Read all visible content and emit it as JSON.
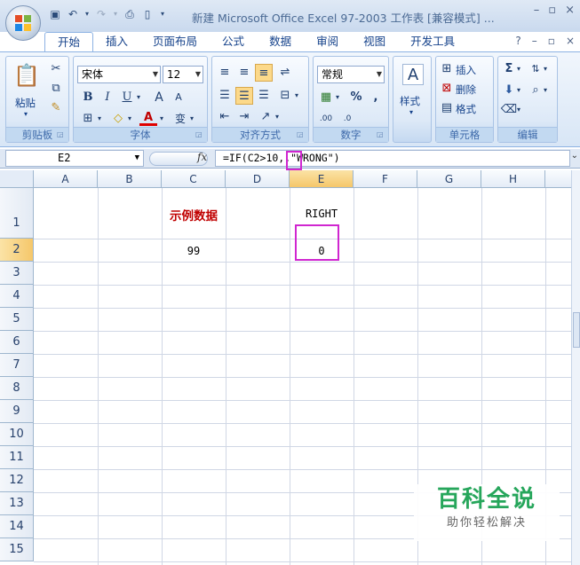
{
  "window": {
    "title": "新建 Microsoft Office Excel 97-2003 工作表  [兼容模式] ...",
    "controls": [
      "–",
      "▫",
      "×"
    ]
  },
  "tabs": [
    "开始",
    "插入",
    "页面布局",
    "公式",
    "数据",
    "审阅",
    "视图",
    "开发工具"
  ],
  "tabs_right": [
    "?",
    "–",
    "▫",
    "×"
  ],
  "ribbon": {
    "clipboard": {
      "label": "剪贴板",
      "paste": "粘贴"
    },
    "font": {
      "label": "字体",
      "font_name": "宋体",
      "font_size": "12",
      "bold": "B",
      "italic": "I",
      "underline": "U",
      "grow": "A",
      "shrink": "A",
      "color_a": "A",
      "wen": "变"
    },
    "align": {
      "label": "对齐方式"
    },
    "number": {
      "label": "数字",
      "format": "常规",
      "percent": "%",
      "comma": ","
    },
    "styles": {
      "label": "样式"
    },
    "cells": {
      "label": "单元格",
      "insert": "插入",
      "delete": "删除",
      "format": "格式"
    },
    "edit": {
      "label": "编辑"
    }
  },
  "formula_bar": {
    "name_box": "E2",
    "formula": "=IF(C2>10,,\"WRONG\")"
  },
  "columns": [
    "A",
    "B",
    "C",
    "D",
    "E",
    "F",
    "G",
    "H"
  ],
  "rows": [
    "1",
    "2",
    "3",
    "4",
    "5",
    "6",
    "7",
    "8",
    "9",
    "10",
    "11",
    "12",
    "13",
    "14",
    "15"
  ],
  "cells": {
    "C1": "示例数据",
    "E1": "RIGHT",
    "C2": "99",
    "E2": "0"
  },
  "watermark": {
    "title": "百科全说",
    "subtitle": "助你轻松解决"
  },
  "colors": {
    "highlight": "#d026d0",
    "red_text": "#c00000",
    "brand_green": "#26a65b"
  }
}
